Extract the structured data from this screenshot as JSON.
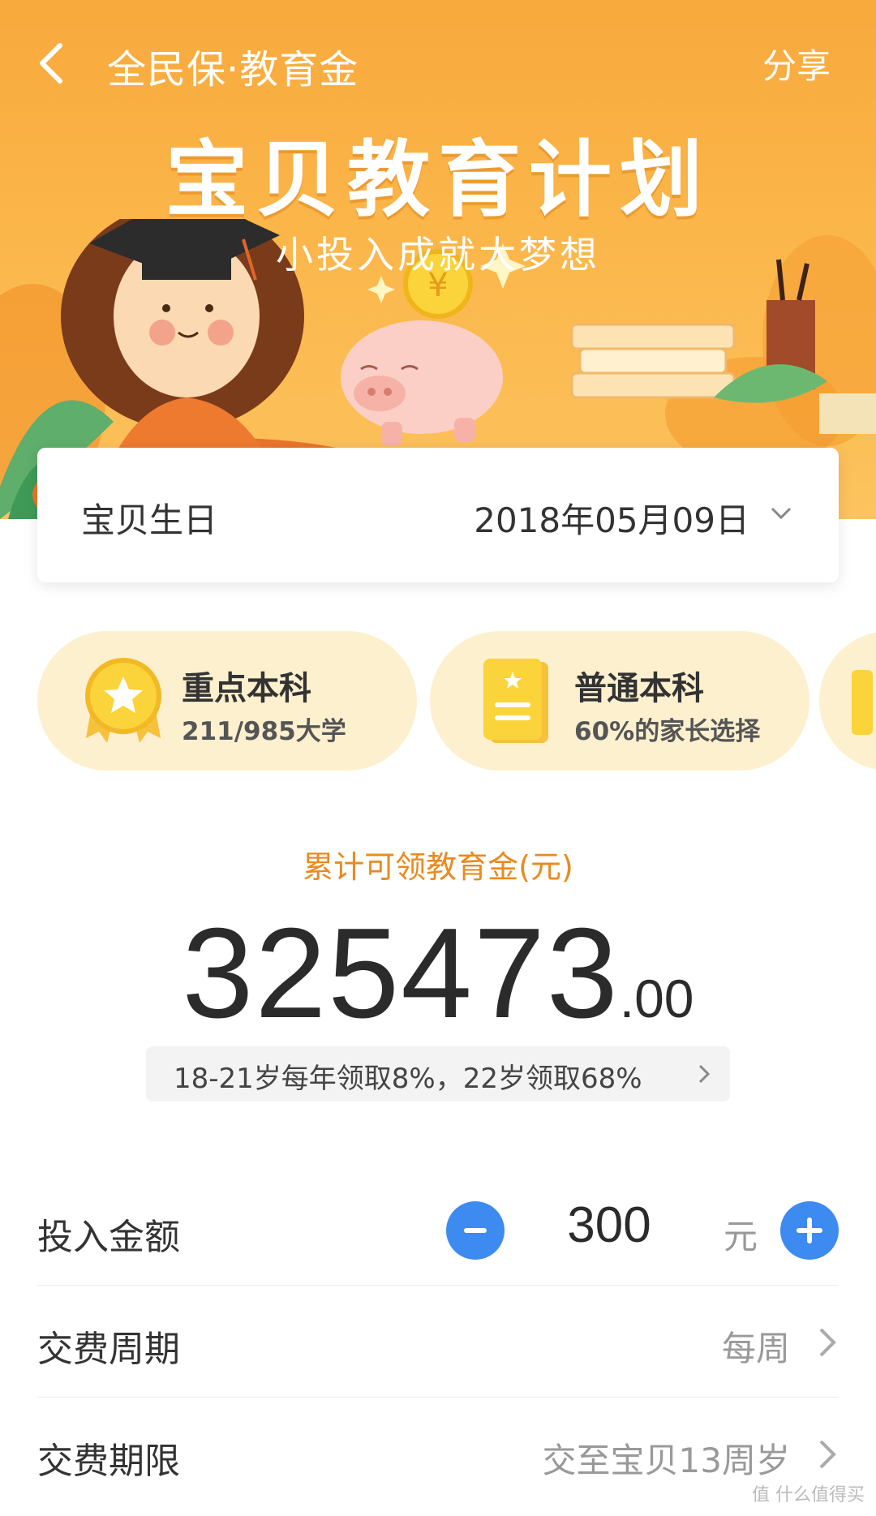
{
  "colors": {
    "banner": "#f8a93c",
    "accent_blue": "#3d8bf0",
    "orange_text": "#e98a1f",
    "card_bg": "#fdf0cf"
  },
  "nav": {
    "back_icon": "chevron-left-icon",
    "title": "全民保·教育金",
    "share_label": "分享"
  },
  "hero": {
    "title": "宝贝教育计划",
    "subtitle": "小投入成就大梦想"
  },
  "birthday": {
    "label": "宝贝生日",
    "value": "2018年05月09日",
    "icon": "chevron-down-icon"
  },
  "plans": [
    {
      "title": "重点本科",
      "desc": "211/985大学",
      "icon": "medal-icon"
    },
    {
      "title": "普通本科",
      "desc": "60%的家长选择",
      "icon": "notebook-icon"
    }
  ],
  "amount": {
    "label": "累计可领教育金(元)",
    "integer": "325473",
    "decimal": ".00"
  },
  "rule": {
    "text": "18-21岁每年领取8%，22岁领取68%"
  },
  "form": {
    "investment": {
      "label": "投入金额",
      "value": "300",
      "unit": "元"
    },
    "period": {
      "label": "交费周期",
      "value": "每周"
    },
    "term": {
      "label": "交费期限",
      "value": "交至宝贝13周岁"
    }
  },
  "watermark": "值 什么值得买"
}
